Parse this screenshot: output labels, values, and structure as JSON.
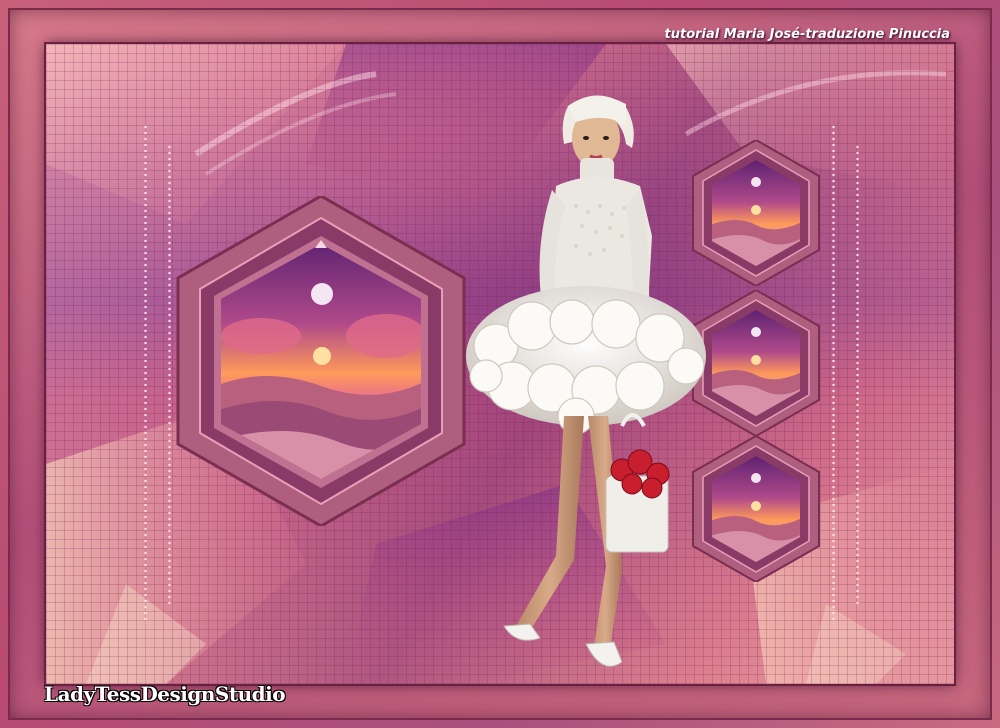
{
  "credit": "tutorial Maria José-traduzione Pinuccia",
  "watermark": "LadyTessDesignStudio",
  "colors": {
    "frame": "#c8607a",
    "canvas_pink": "#d88090",
    "canvas_purple": "#9a4a90",
    "hex_border": "#b8607e",
    "sunset_orange": "#ff9a6a",
    "sky_purple": "#7a3a8a",
    "dress_white": "#f2f0ec",
    "roses_red": "#c81e2e"
  },
  "scene": {
    "subject": "woman-in-white-dress",
    "hexagon_frames": [
      "large-sunset-hex",
      "small-sunset-hex-top",
      "small-sunset-hex-middle",
      "small-sunset-hex-bottom"
    ]
  }
}
